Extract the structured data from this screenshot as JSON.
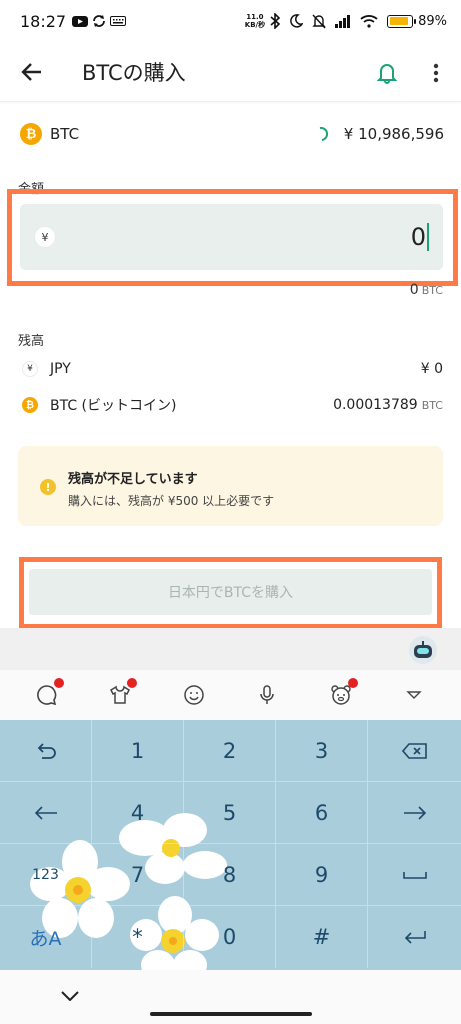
{
  "status_bar": {
    "time": "18:27",
    "net_speed_top": "11.0",
    "net_speed_bottom": "KB/秒",
    "battery": "89%",
    "battery_level": 0.89
  },
  "header": {
    "title": "BTCの購入"
  },
  "price": {
    "coin_symbol": "BTC",
    "coin_icon_glyph": "₿",
    "value": "¥ 10,986,596"
  },
  "amount": {
    "label": "金額",
    "currency_glyph": "¥",
    "value": "0",
    "btc_value": "0",
    "btc_unit": "BTC"
  },
  "balance": {
    "label": "残高",
    "rows": [
      {
        "name": "JPY",
        "icon": "yen-icon",
        "amount": "¥ 0",
        "unit": ""
      },
      {
        "name": "BTC (ビットコイン)",
        "icon": "bitcoin-icon",
        "amount": "0.00013789",
        "unit": "BTC"
      }
    ]
  },
  "warning": {
    "glyph": "!",
    "title": "残高が不足しています",
    "text": "購入には、残高が ¥500 以上必要です"
  },
  "buy_button": {
    "label": "日本円でBTCを購入"
  },
  "keyboard": {
    "rows": [
      [
        "undo",
        "1",
        "2",
        "3",
        "backspace"
      ],
      [
        "left",
        "4",
        "5",
        "6",
        "right"
      ],
      [
        "123",
        "7",
        "8",
        "9",
        "space"
      ],
      [
        "あA",
        "*",
        "0",
        "#",
        "enter"
      ]
    ],
    "labels": {
      "k1": "1",
      "k2": "2",
      "k3": "3",
      "k4": "4",
      "k5": "5",
      "k6": "6",
      "k7": "7",
      "k8": "8",
      "k9": "9",
      "k123": "123",
      "kmode": "あA",
      "kstar": "*",
      "k0": "0",
      "khash": "#"
    }
  },
  "colors": {
    "accent": "#1aa378",
    "highlight": "#ff7a45",
    "btc": "#f7a600",
    "keyboard_bg": "#a9cddb"
  }
}
